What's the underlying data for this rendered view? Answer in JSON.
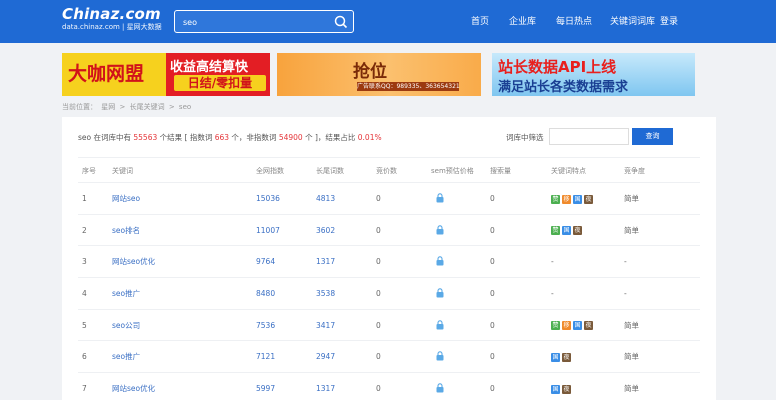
{
  "header": {
    "logo_main": "Chinaz.com",
    "logo_sub": "data.chinaz.com | 星网大数据",
    "search_value": "seo",
    "nav": [
      "首页",
      "企业库",
      "每日热点",
      "关键词词库",
      "登录"
    ]
  },
  "banners": {
    "b1_left": "大咖网盟",
    "b1_r1": "收益高结算快",
    "b1_r2": "日结/零扣量",
    "b2_title": "抢位",
    "b2_sub": "广告联系QQ：989335、363654321",
    "b3_line1": "站长数据API上线",
    "b3_line2": "满足站长各类数据需求"
  },
  "breadcrumb": [
    "当前位置：",
    "星网",
    ">",
    "长尾关键词",
    ">",
    "seo"
  ],
  "summary": {
    "p1": "seo 在词库中有 ",
    "count": "55563",
    "p2": " 个结果 [ 指数词 ",
    "index_words": "663",
    "p3": " 个，非指数词 ",
    "non_index_words": "54900",
    "p4": " 个 ]，结果占比 ",
    "ratio": "0.01%"
  },
  "filter": {
    "label": "词库中筛选",
    "button": "查询"
  },
  "columns": [
    "序号",
    "关键词",
    "全网指数",
    "长尾词数",
    "竞价数",
    "sem预估价格",
    "搜索量",
    "关键词特点",
    "竞争度"
  ],
  "rows": [
    {
      "no": "1",
      "keyword": "网站seo",
      "index": "15036",
      "longtail": "4813",
      "bid": "0",
      "search": "0",
      "features": [
        "g",
        "o",
        "b",
        "d"
      ],
      "comp": "简单"
    },
    {
      "no": "2",
      "keyword": "seo排名",
      "index": "11007",
      "longtail": "3602",
      "bid": "0",
      "search": "0",
      "features": [
        "g",
        "b",
        "d"
      ],
      "comp": "简单"
    },
    {
      "no": "3",
      "keyword": "网站seo优化",
      "index": "9764",
      "longtail": "1317",
      "bid": "0",
      "search": "0",
      "features": [],
      "feature_text": "-",
      "comp": "-"
    },
    {
      "no": "4",
      "keyword": "seo推广",
      "index": "8480",
      "longtail": "3538",
      "bid": "0",
      "search": "0",
      "features": [],
      "feature_text": "-",
      "comp": "-"
    },
    {
      "no": "5",
      "keyword": "seo公司",
      "index": "7536",
      "longtail": "3417",
      "bid": "0",
      "search": "0",
      "features": [
        "g",
        "o",
        "b",
        "d"
      ],
      "comp": "简单"
    },
    {
      "no": "6",
      "keyword": "seo推广",
      "index": "7121",
      "longtail": "2947",
      "bid": "0",
      "search": "0",
      "features": [
        "b",
        "d"
      ],
      "comp": "简单"
    },
    {
      "no": "7",
      "keyword": "网站seo优化",
      "index": "5997",
      "longtail": "1317",
      "bid": "0",
      "search": "0",
      "features": [
        "b",
        "d"
      ],
      "comp": "简单"
    }
  ],
  "feature_glyphs": {
    "g": "赞",
    "o": "移",
    "b": "国",
    "d": "夜"
  }
}
